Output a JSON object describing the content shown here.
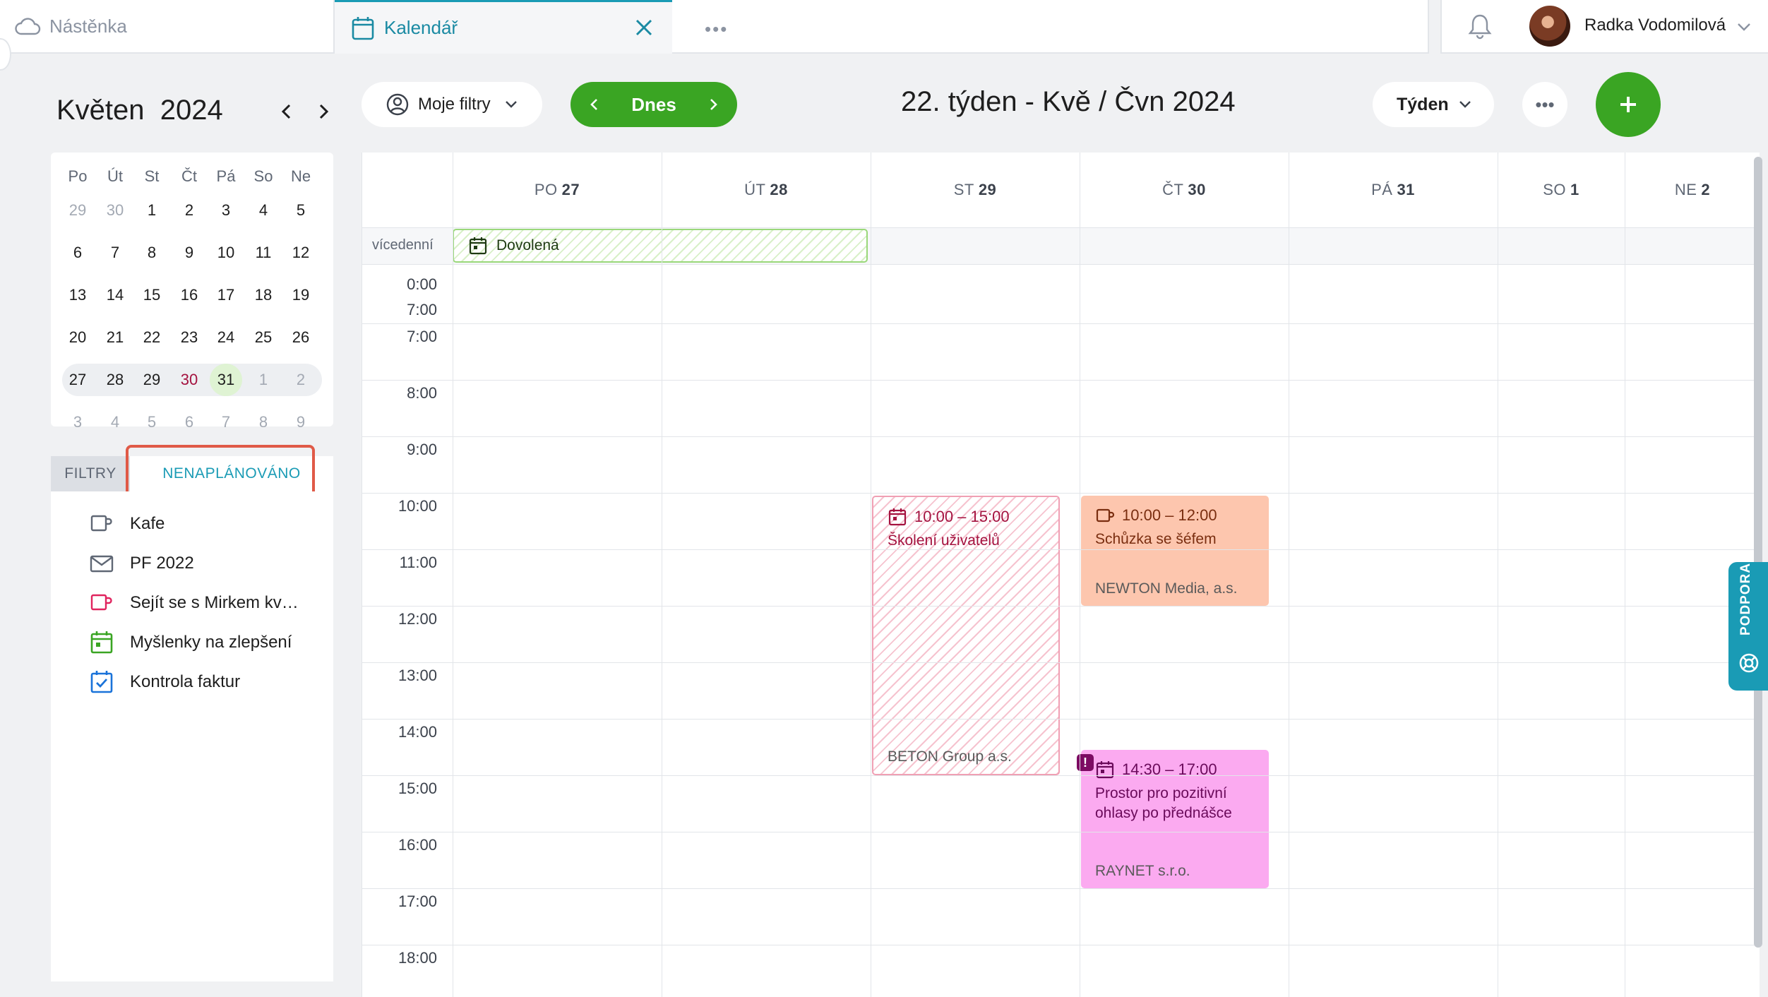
{
  "tabs": {
    "dashboard": "Nástěnka",
    "calendar": "Kalendář",
    "more": "•••"
  },
  "user": {
    "name": "Radka Vodomilová"
  },
  "mini_calendar": {
    "title_month": "Květen",
    "title_year": "2024",
    "weekdays": [
      "Po",
      "Út",
      "St",
      "Čt",
      "Pá",
      "So",
      "Ne"
    ],
    "weeks": [
      [
        "29",
        "30",
        "1",
        "2",
        "3",
        "4",
        "5"
      ],
      [
        "6",
        "7",
        "8",
        "9",
        "10",
        "11",
        "12"
      ],
      [
        "13",
        "14",
        "15",
        "16",
        "17",
        "18",
        "19"
      ],
      [
        "20",
        "21",
        "22",
        "23",
        "24",
        "25",
        "26"
      ],
      [
        "27",
        "28",
        "29",
        "30",
        "31",
        "1",
        "2"
      ],
      [
        "3",
        "4",
        "5",
        "6",
        "7",
        "8",
        "9"
      ]
    ],
    "today": "31"
  },
  "side_tabs": {
    "filters": "FILTRY",
    "unplanned": "NENAPLÁNOVÁNO"
  },
  "unplanned_items": [
    {
      "icon": "coffee-icon",
      "label": "Kafe",
      "color": "#5f6774"
    },
    {
      "icon": "envelope-icon",
      "label": "PF 2022",
      "color": "#5f6774"
    },
    {
      "icon": "coffee-icon",
      "label": "Sejít se s Mirkem kv…",
      "color": "#e0245e"
    },
    {
      "icon": "calendar-event-icon",
      "label": "Myšlenky na zlepšení",
      "color": "#3aa523"
    },
    {
      "icon": "checkbox-icon",
      "label": "Kontrola faktur",
      "color": "#1a73d9"
    }
  ],
  "toolbar": {
    "filters_label": "Moje filtry",
    "today_label": "Dnes",
    "week_title": "22. týden - Kvě / Čvn 2024",
    "view_label": "Týden",
    "more_label": "•••"
  },
  "week": {
    "days": [
      {
        "dow": "PO",
        "date": "27"
      },
      {
        "dow": "ÚT",
        "date": "28"
      },
      {
        "dow": "ST",
        "date": "29"
      },
      {
        "dow": "ČT",
        "date": "30"
      },
      {
        "dow": "PÁ",
        "date": "31"
      },
      {
        "dow": "SO",
        "date": "1"
      },
      {
        "dow": "NE",
        "date": "2"
      }
    ],
    "allday_label": "vícedenní",
    "hours": [
      "0:00",
      "7:00",
      "7:00",
      "8:00",
      "9:00",
      "10:00",
      "11:00",
      "12:00",
      "13:00",
      "14:00",
      "15:00",
      "16:00",
      "17:00",
      "18:00"
    ]
  },
  "events": {
    "vacation": {
      "title": "Dovolená"
    },
    "training": {
      "time": "10:00 – 15:00",
      "title": "Školení uživatelů",
      "company": "BETON Group a.s."
    },
    "meeting": {
      "time": "10:00 – 12:00",
      "title": "Schůzka se šéfem",
      "company": "NEWTON Media, a.s."
    },
    "space": {
      "time": "14:30 – 17:00",
      "title": "Prostor pro pozitivní ohlasy po přednášce",
      "company": "RAYNET s.r.o.",
      "warning": "!"
    }
  },
  "support": {
    "label": "PODPORA"
  },
  "colors": {
    "accent": "#1a9bb5",
    "green": "#3aa523",
    "highlight": "#e05a47"
  }
}
